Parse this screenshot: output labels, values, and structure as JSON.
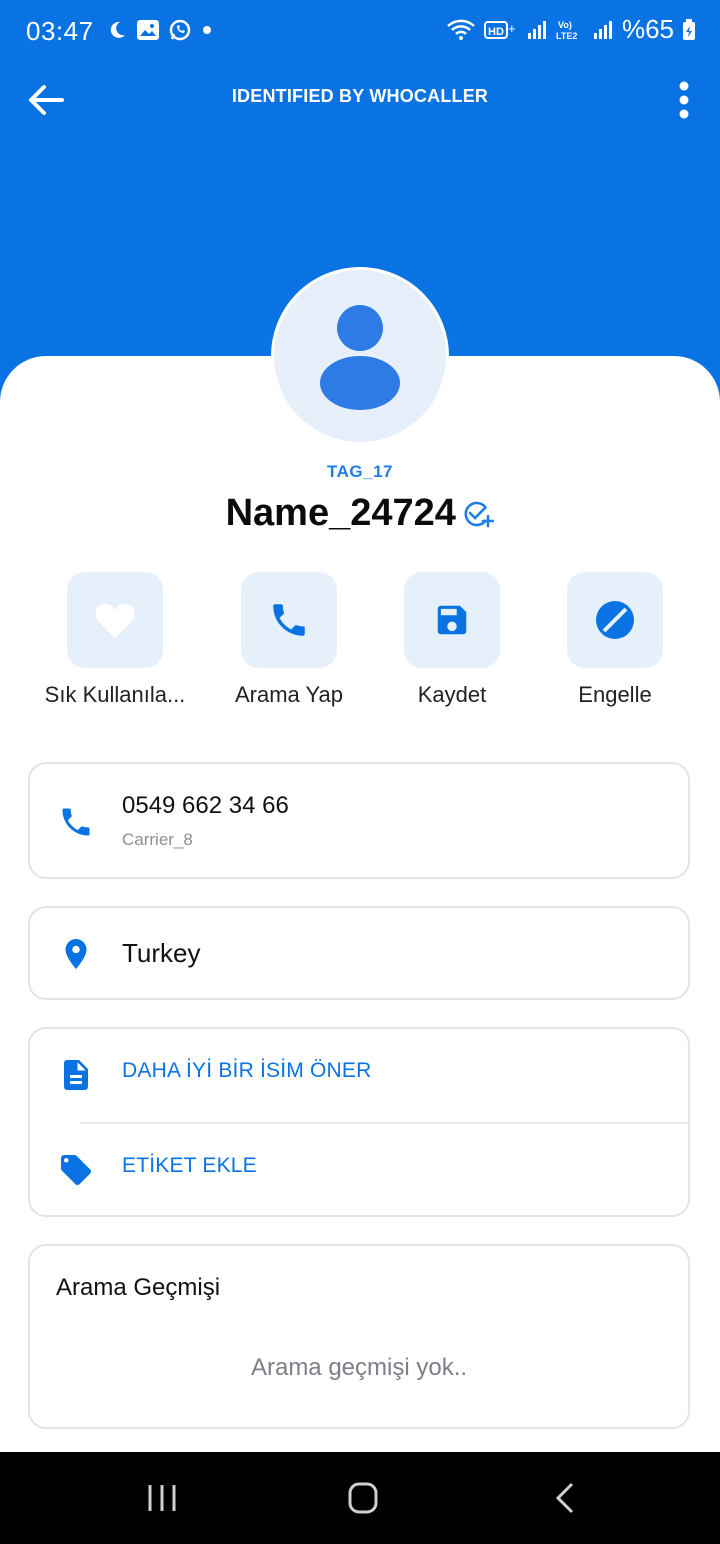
{
  "status_bar": {
    "time": "03:47",
    "battery": "%65",
    "left_icons": [
      "moon-icon",
      "image-icon",
      "whatsapp-icon",
      "dot-icon"
    ],
    "right_icons": [
      "wifi-icon",
      "hd-icon",
      "signal-icon",
      "volte-icon",
      "signal-icon",
      "battery-icon"
    ]
  },
  "app_bar": {
    "title": "IDENTIFIED BY WHOCALLER"
  },
  "profile": {
    "tag": "TAG_17",
    "name": "Name_24724"
  },
  "actions": [
    {
      "label": "Sık Kullanıla...",
      "icon": "heart-icon"
    },
    {
      "label": "Arama Yap",
      "icon": "phone-icon"
    },
    {
      "label": "Kaydet",
      "icon": "save-icon"
    },
    {
      "label": "Engelle",
      "icon": "block-icon"
    }
  ],
  "phone_card": {
    "number": "0549 662 34 66",
    "carrier": "Carrier_8"
  },
  "location_card": {
    "country": "Turkey"
  },
  "links": {
    "suggest_name": "DAHA İYİ BİR İSİM ÖNER",
    "add_tag": "ETİKET EKLE"
  },
  "history": {
    "title": "Arama Geçmişi",
    "empty": "Arama geçmişi yok.."
  },
  "colors": {
    "primary": "#0a73e3",
    "action_bg": "#e6f0fb",
    "avatar_bg": "#e7effa",
    "avatar_fg": "#2f7be6"
  }
}
